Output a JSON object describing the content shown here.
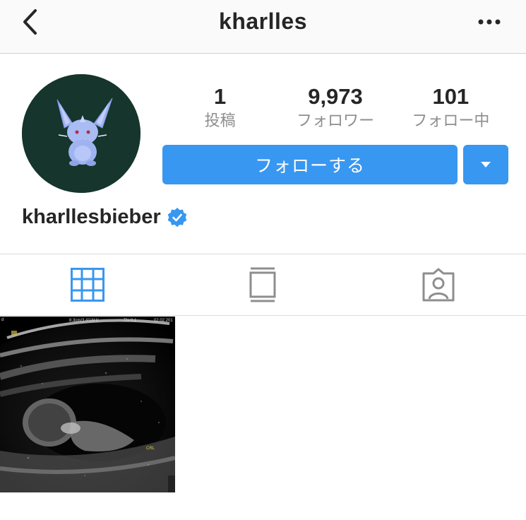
{
  "header": {
    "title": "kharlles",
    "back_icon": "chevron-left-icon",
    "more_icon": "ellipsis-icon"
  },
  "profile": {
    "username": "kharllesbieber",
    "verified": true,
    "stats": [
      {
        "value": "1",
        "label": "投稿"
      },
      {
        "value": "9,973",
        "label": "フォロワー"
      },
      {
        "value": "101",
        "label": "フォロー中"
      }
    ],
    "follow_label": "フォローする",
    "accent_color": "#3897f0"
  },
  "tabs": [
    {
      "name": "grid",
      "icon": "grid-icon",
      "active": true
    },
    {
      "name": "feed",
      "icon": "feed-icon",
      "active": false
    },
    {
      "name": "tagged",
      "icon": "tagged-icon",
      "active": false
    }
  ],
  "posts": [
    {
      "overlay_top": "8.3cm/3.4/16Hz",
      "overlay_tis": "TIs 0.1",
      "overlay_date": "02.02.201",
      "overlay_crl": "CRL"
    }
  ]
}
